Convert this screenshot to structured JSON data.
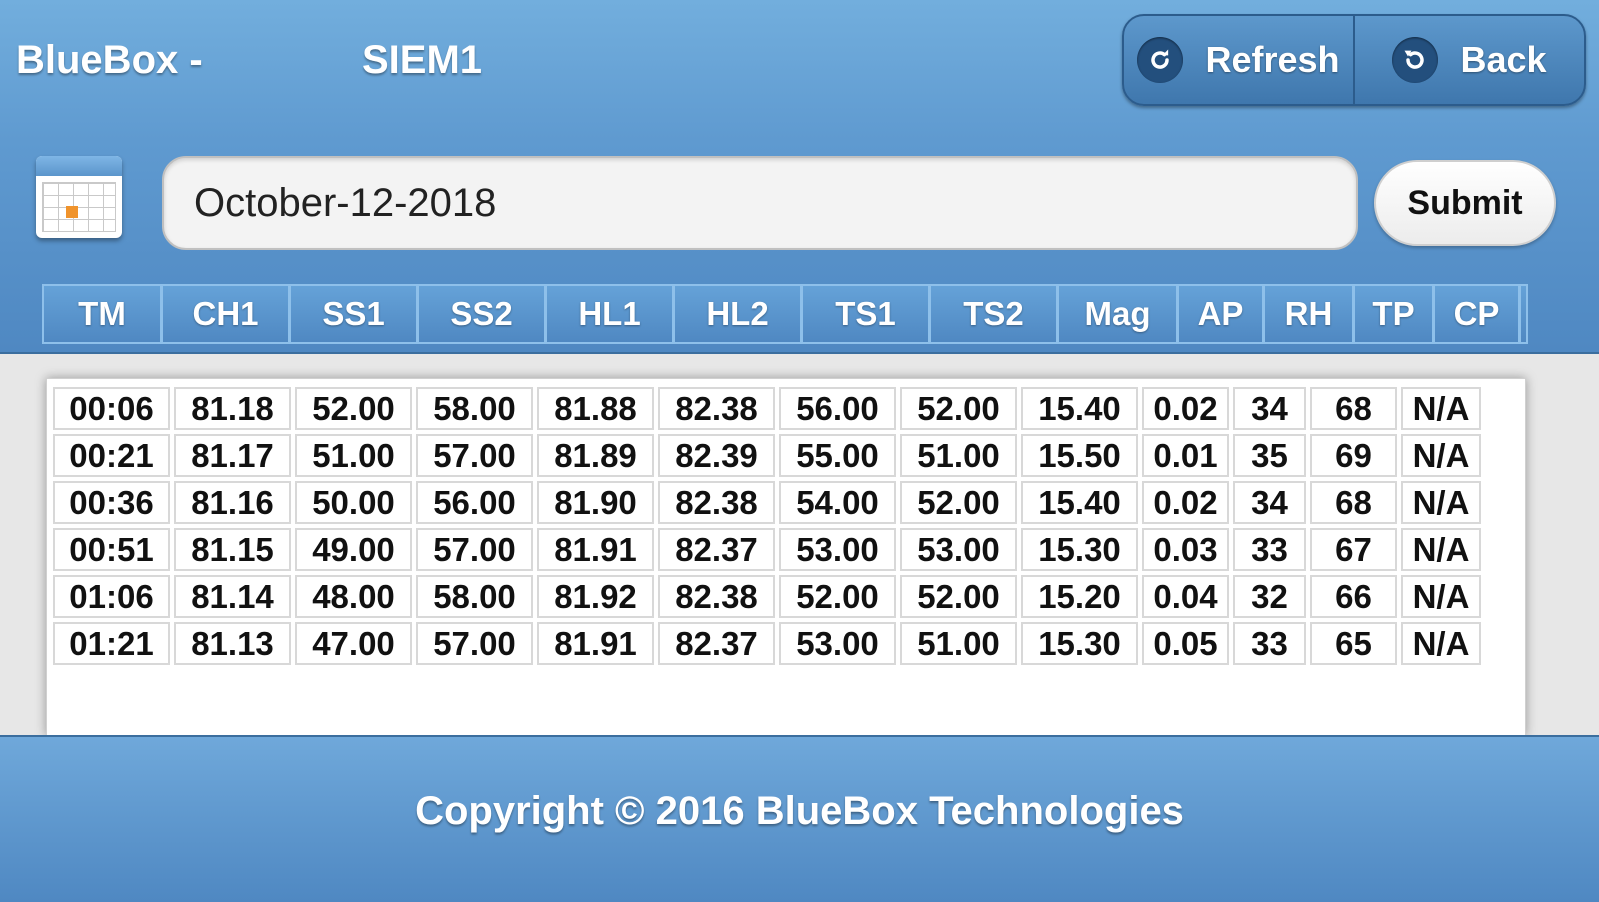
{
  "header": {
    "app_title": "BlueBox -",
    "device_name": "SIEM1",
    "buttons": {
      "refresh_label": "Refresh",
      "back_label": "Back"
    }
  },
  "date_form": {
    "date_value": "October-12-2018",
    "submit_label": "Submit"
  },
  "table": {
    "columns": [
      "TM",
      "CH1",
      "SS1",
      "SS2",
      "HL1",
      "HL2",
      "TS1",
      "TS2",
      "Mag",
      "AP",
      "RH",
      "TP",
      "CP"
    ],
    "rows": [
      [
        "00:06",
        "81.18",
        "52.00",
        "58.00",
        "81.88",
        "82.38",
        "56.00",
        "52.00",
        "15.40",
        "0.02",
        "34",
        "68",
        "N/A"
      ],
      [
        "00:21",
        "81.17",
        "51.00",
        "57.00",
        "81.89",
        "82.39",
        "55.00",
        "51.00",
        "15.50",
        "0.01",
        "35",
        "69",
        "N/A"
      ],
      [
        "00:36",
        "81.16",
        "50.00",
        "56.00",
        "81.90",
        "82.38",
        "54.00",
        "52.00",
        "15.40",
        "0.02",
        "34",
        "68",
        "N/A"
      ],
      [
        "00:51",
        "81.15",
        "49.00",
        "57.00",
        "81.91",
        "82.37",
        "53.00",
        "53.00",
        "15.30",
        "0.03",
        "33",
        "67",
        "N/A"
      ],
      [
        "01:06",
        "81.14",
        "48.00",
        "58.00",
        "81.92",
        "82.38",
        "52.00",
        "52.00",
        "15.20",
        "0.04",
        "32",
        "66",
        "N/A"
      ],
      [
        "01:21",
        "81.13",
        "47.00",
        "57.00",
        "81.91",
        "82.37",
        "53.00",
        "51.00",
        "15.30",
        "0.05",
        "33",
        "65",
        "N/A"
      ]
    ]
  },
  "footer": {
    "copyright": "Copyright © 2016 BlueBox Technologies"
  }
}
